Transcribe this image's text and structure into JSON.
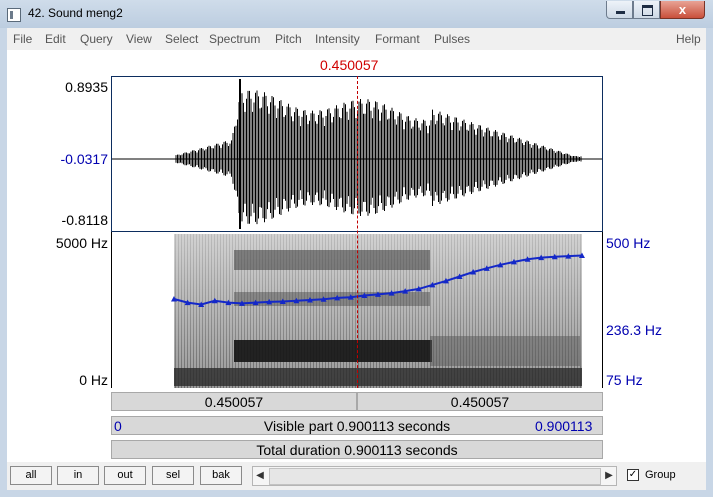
{
  "window": {
    "title": "42. Sound meng2",
    "close_glyph": "x",
    "icons": [
      "app-icon",
      "minimize-icon",
      "maximize-icon",
      "close-icon"
    ]
  },
  "menu": [
    "File",
    "Edit",
    "Query",
    "View",
    "Select",
    "Spectrum",
    "Pitch",
    "Intensity",
    "Formant",
    "Pulses",
    "Help"
  ],
  "cursor_time": "0.450057",
  "waveform": {
    "y_top": "0.8935",
    "y_cursor": "-0.0317",
    "y_bottom": "-0.8118"
  },
  "spectrogram": {
    "freq_top": "5000 Hz",
    "freq_bottom": "0 Hz",
    "pitch_top": "500 Hz",
    "pitch_cursor": "236.3 Hz",
    "pitch_bottom": "75 Hz"
  },
  "selection": {
    "left": "0.450057",
    "right": "0.450057"
  },
  "visible": {
    "start": "0",
    "label": "Visible part 0.900113 seconds",
    "end": "0.900113"
  },
  "total": {
    "label": "Total duration 0.900113 seconds"
  },
  "buttons": [
    "all",
    "in",
    "out",
    "sel",
    "bak"
  ],
  "scroll": {
    "left_glyph": "◀",
    "right_glyph": "▶"
  },
  "group": {
    "label": "Group",
    "checked": true,
    "check_glyph": "✓"
  },
  "colors": {
    "cursor": "#d00000",
    "pitch": "#1428c8",
    "accent_text": "#0000b0"
  },
  "chart_data": {
    "type": "line",
    "pitch_contour_hz": {
      "x": [
        0.0,
        0.03,
        0.06,
        0.09,
        0.12,
        0.15,
        0.18,
        0.21,
        0.24,
        0.27,
        0.3,
        0.33,
        0.36,
        0.39,
        0.42,
        0.45,
        0.48,
        0.51,
        0.54,
        0.57,
        0.6,
        0.63,
        0.66,
        0.69,
        0.72,
        0.75,
        0.78,
        0.81,
        0.84,
        0.87,
        0.9
      ],
      "y": [
        215,
        205,
        200,
        210,
        205,
        203,
        205,
        207,
        208,
        210,
        212,
        214,
        218,
        220,
        225,
        228,
        232,
        238,
        245,
        258,
        272,
        288,
        305,
        320,
        335,
        348,
        360,
        368,
        372,
        375,
        378
      ]
    }
  }
}
